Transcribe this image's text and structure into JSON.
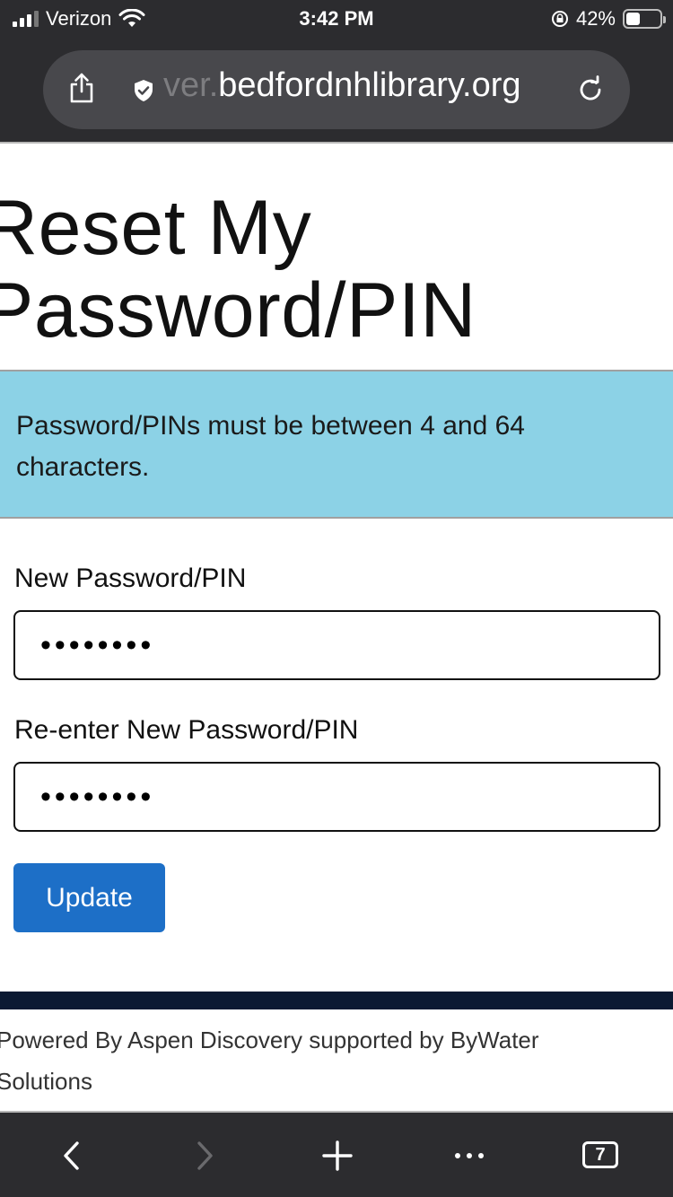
{
  "status_bar": {
    "carrier": "Verizon",
    "time": "3:42 PM",
    "battery_text": "42%",
    "battery_level": 0.42
  },
  "browser": {
    "url_faded": "ver.",
    "url_main": "bedfordnhlibrary.org",
    "tab_count": "7"
  },
  "page": {
    "title": "Reset My Password/PIN",
    "alert_text": "Password/PINs must be between 4 and 64 characters.",
    "new_password_label": "New Password/PIN",
    "new_password_value": "••••••••",
    "reenter_password_label": "Re-enter New Password/PIN",
    "reenter_password_value": "••••••••",
    "update_label": "Update",
    "footer": "Powered By Aspen Discovery supported by ByWater Solutions"
  },
  "colors": {
    "alert_bg": "#8cd2e6",
    "button_bg": "#1d6fc7",
    "footer_bar": "#0c1a33",
    "chrome_bg": "#2c2c2f"
  },
  "icons": [
    "signal-icon",
    "wifi-icon",
    "rotation-lock-icon",
    "battery-icon",
    "share-icon",
    "shield-icon",
    "reload-icon",
    "back-icon",
    "forward-icon",
    "new-tab-icon",
    "more-icon",
    "tabs-icon"
  ]
}
